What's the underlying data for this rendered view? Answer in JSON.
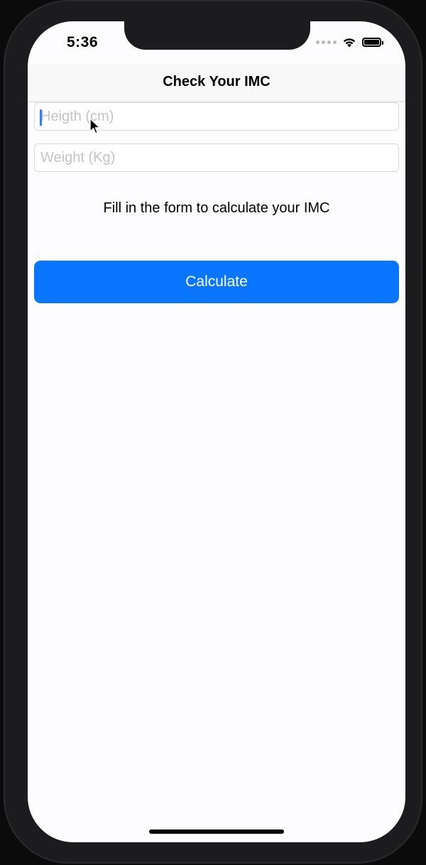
{
  "status_bar": {
    "time": "5:36",
    "icons": [
      "signal-dots-icon",
      "wifi-icon",
      "battery-icon"
    ]
  },
  "nav": {
    "title": "Check Your IMC"
  },
  "form": {
    "height_field": {
      "placeholder": "Heigth (cm)",
      "value": ""
    },
    "weight_field": {
      "placeholder": "Weight (Kg)",
      "value": ""
    },
    "hint": "Fill in the form to calculate your IMC",
    "calculate_label": "Calculate"
  },
  "colors": {
    "accent": "#0A76FF",
    "background": "#FDFCFE",
    "placeholder": "#C4C4C7",
    "caret": "#2F7FF6"
  }
}
